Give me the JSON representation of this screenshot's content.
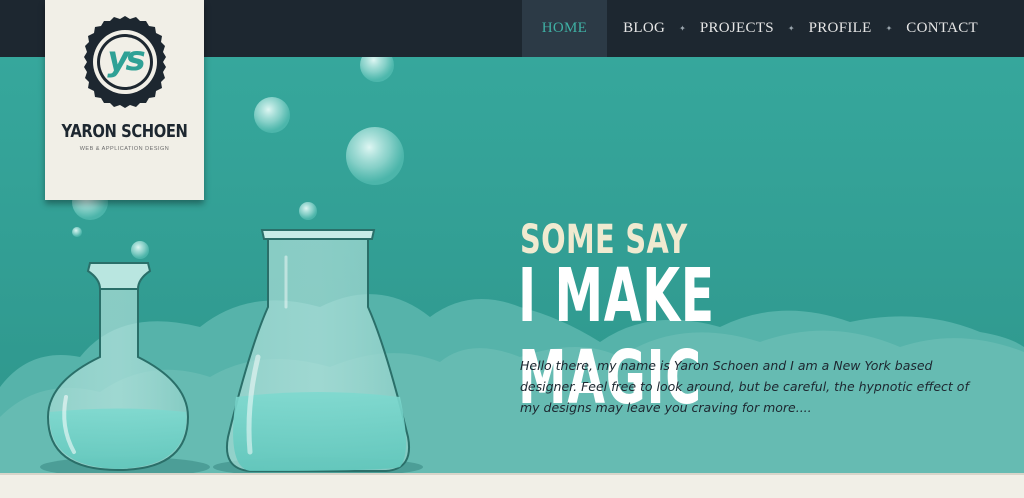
{
  "nav": {
    "items": [
      {
        "label": "HOME"
      },
      {
        "label": "BLOG"
      },
      {
        "label": "PROJECTS"
      },
      {
        "label": "PROFILE"
      },
      {
        "label": "CONTACT"
      }
    ],
    "separator": "✦"
  },
  "logo": {
    "monogram": "ys",
    "name": "YARON SCHOEN",
    "tagline": "WEB & APPLICATION DESIGN"
  },
  "hero": {
    "line1": "SOME SAY",
    "line2": "I MAKE MAGIC",
    "intro": "Hello there, my name is Yaron Schoen and I am a New York based designer. Feel free to look around, but be careful, the hypnotic effect of my designs may leave you craving for more...."
  },
  "colors": {
    "topbar": "#1d2730",
    "hero_bg": "#33a298",
    "accent": "#3fb0a4",
    "cream": "#f1efe7"
  }
}
